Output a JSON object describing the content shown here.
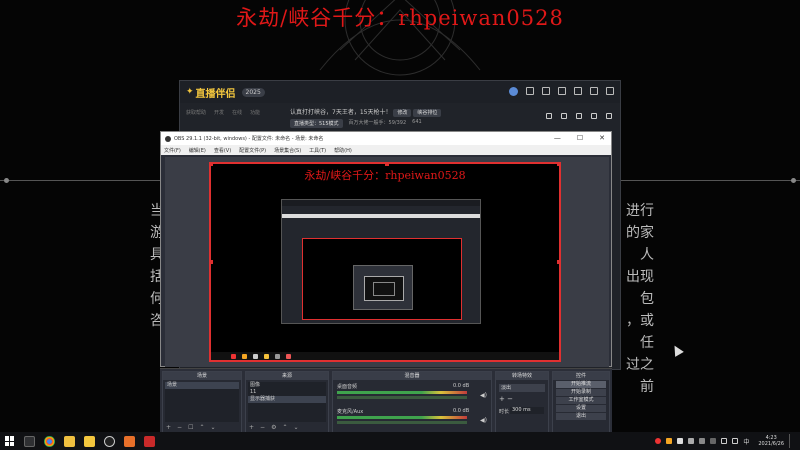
{
  "watermark": {
    "title": "永劫/峡谷千分：rhpeiwan0528"
  },
  "background_text": {
    "left_lines": [
      "当",
      "游",
      "具",
      "括",
      "何",
      "咨"
    ],
    "right_lines": [
      "进行",
      "的家人",
      "出现包",
      "，或任",
      "过之前"
    ]
  },
  "companion_app": {
    "logo": "直播伴侣",
    "badge": "2025",
    "tabs": [
      "获取帮助",
      "开发",
      "在线",
      "功能"
    ],
    "status_line": "认真打打峡谷，7天王者，15天枪十！",
    "status_button": "修改",
    "mode_button": "峡谷排位",
    "row2": [
      "直播类型：515模式",
      "百万大佬一般手：59/392",
      "641"
    ]
  },
  "obs": {
    "title": "OBS 29.1.1 (32-bit, windows) - 配置文件: 未命名 - 场景: 未命名",
    "menu": [
      "文件(F)",
      "编辑(E)",
      "查看(V)",
      "配置文件(P)",
      "场景集合(S)",
      "工具(T)",
      "帮助(H)"
    ],
    "window_controls": [
      "—",
      "☐",
      "✕"
    ],
    "preview_title": "永劫/峡谷千分：rhpeiwan0528",
    "docks": {
      "scenes": {
        "title": "场景",
        "items": [
          "场景"
        ]
      },
      "sources": {
        "title": "来源",
        "items": [
          "图像",
          "11",
          "显示器捕获"
        ]
      },
      "mixer": {
        "title": "混音器",
        "channels": [
          {
            "name": "桌面音频",
            "db": "0.0 dB"
          },
          {
            "name": "麦克风/Aux",
            "db": "0.0 dB"
          }
        ]
      },
      "transitions": {
        "title": "转场特效",
        "type": "淡出",
        "duration_label": "时长",
        "duration": "300 ms"
      },
      "controls": {
        "title": "控件",
        "buttons": [
          "开始推流",
          "开始录制",
          "工作室模式",
          "设置",
          "退出"
        ]
      }
    }
  },
  "taskbar": {
    "time": "4:23",
    "date": "2021/6/26"
  },
  "colors": {
    "accent_red": "#e01818",
    "obs_bg": "#2b2e38",
    "app_logo": "#f4c73e"
  }
}
